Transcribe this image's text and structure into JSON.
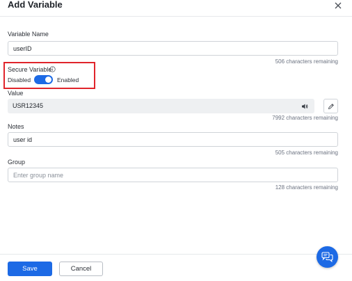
{
  "dialog": {
    "title": "Add Variable"
  },
  "fields": {
    "variable_name": {
      "label": "Variable Name",
      "value": "userID",
      "hint": "506 characters remaining"
    },
    "secure": {
      "label": "Secure Variable",
      "off_label": "Disabled",
      "on_label": "Enabled",
      "enabled": true
    },
    "value": {
      "label": "Value",
      "value": "USR12345",
      "hint": "7992 characters remaining"
    },
    "notes": {
      "label": "Notes",
      "value": "user id",
      "hint": "505 characters remaining"
    },
    "group": {
      "label": "Group",
      "value": "",
      "placeholder": "Enter group name",
      "hint": "128 characters remaining"
    }
  },
  "footer": {
    "save_label": "Save",
    "cancel_label": "Cancel"
  },
  "icons": {
    "close": "close-icon",
    "info": "info-icon",
    "speaker": "speaker-icon",
    "edit": "pencil-icon",
    "chat": "chat-icon"
  },
  "colors": {
    "accent": "#1d6ae5",
    "highlight": "#e0242b"
  }
}
